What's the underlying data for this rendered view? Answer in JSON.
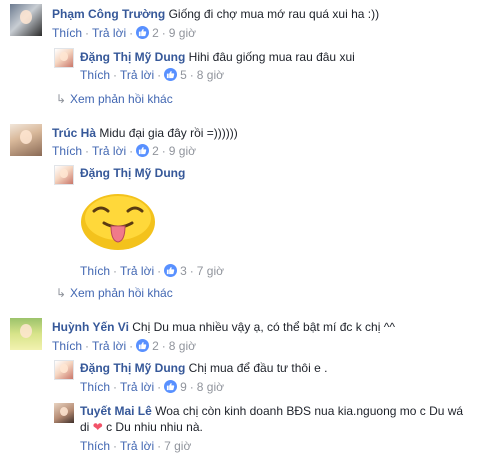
{
  "labels": {
    "like": "Thích",
    "reply": "Trả lời",
    "more_replies": "Xem phản hồi khác"
  },
  "comments": [
    {
      "name": "Phạm Công Trường",
      "text": "Giống đi chợ mua mớ rau quá xui ha :))",
      "likes": "2",
      "time": "9 giờ"
    },
    {
      "name": "Đặng Thị Mỹ Dung",
      "text": "Hihi đâu giống mua rau đâu xui",
      "likes": "5",
      "time": "8 giờ"
    },
    {
      "name": "Trúc Hà",
      "text": "Midu đại gia đây rồi =))))))",
      "likes": "2",
      "time": "9 giờ"
    },
    {
      "name": "Đặng Thị Mỹ Dung",
      "text": "",
      "sticker": "tongue-out-emoji-sticker",
      "likes": "3",
      "time": "7 giờ"
    },
    {
      "name": "Huỳnh Yến Vi",
      "text": "Chị Du mua nhiều vậy ạ, có thể bật mí đc k chị ^^",
      "likes": "2",
      "time": "8 giờ"
    },
    {
      "name": "Đặng Thị Mỹ Dung",
      "text": "Chị mua để đầu tư thôi e .",
      "likes": "9",
      "time": "8 giờ"
    },
    {
      "name": "Tuyết Mai Lê",
      "text": "Woa chị còn kinh doanh BĐS nua kia.nguong mo c Du wá",
      "text_line2_start": "di",
      "text_line2_end": "c Du nhiu nhiu nà.",
      "time": "7 giờ"
    }
  ],
  "colors": {
    "name_link": "#365899",
    "action_link": "#4267b2",
    "meta_gray": "#90949c",
    "like_blue": "#5890ff",
    "heart": "#f25268"
  }
}
